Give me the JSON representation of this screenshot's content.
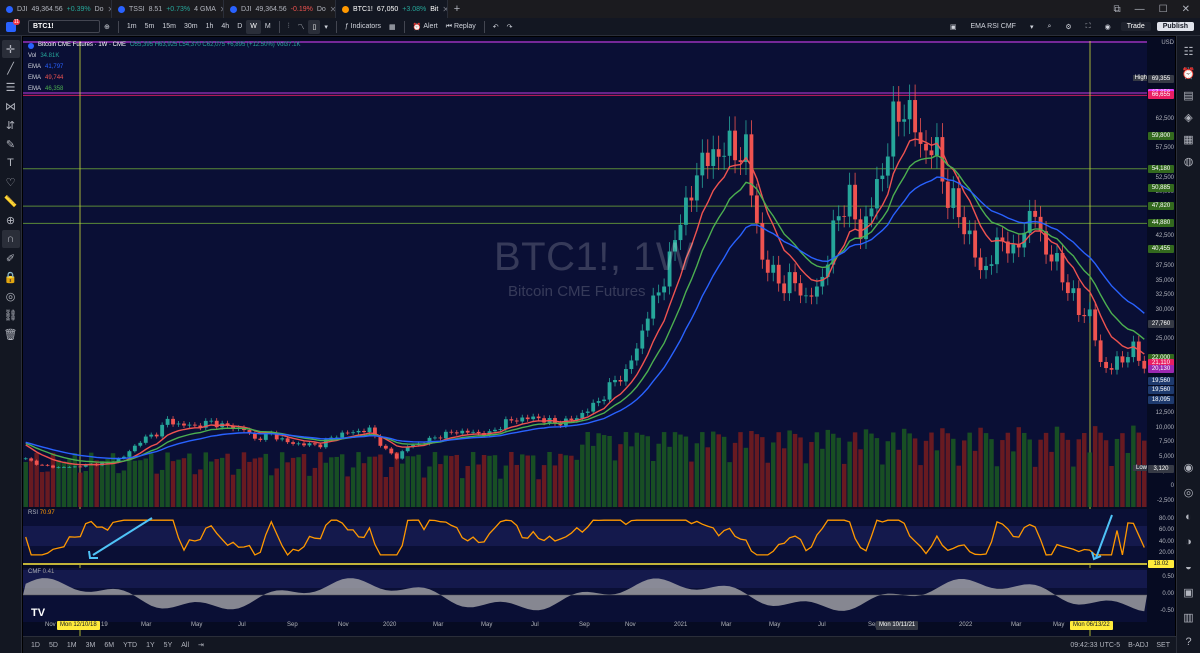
{
  "browser_tabs": [
    {
      "symbol": "DJI",
      "change": "+0.39%",
      "more": "Do",
      "dir": "up",
      "active": false
    },
    {
      "symbol": "TSSI",
      "change": "+0.73%",
      "more": "4 GMA",
      "dir": "up",
      "active": false
    },
    {
      "symbol": "DJI",
      "change": "-0.19%",
      "more": "Do",
      "dir": "dn",
      "active": false
    },
    {
      "symbol": "BTC1!",
      "change": "+3.08%",
      "more": "Bit",
      "dir": "up",
      "active": true
    }
  ],
  "browser_tab_prices": [
    "49,364.56",
    "8.51",
    "49,364.56",
    "67,050"
  ],
  "toolbar": {
    "notif_badge": "11",
    "symbol": "BTC1!",
    "intervals": [
      "1m",
      "5m",
      "15m",
      "30m",
      "1h",
      "4h",
      "D",
      "W",
      "M"
    ],
    "selected_interval": "W",
    "indicators_label": "Indicators",
    "alert_label": "Alert",
    "replay_label": "Replay",
    "layout_name": "EMA RSI CMF",
    "trade_label": "Trade",
    "publish_label": "Publish"
  },
  "legend": {
    "symbol_title": "Bitcoin CME Futures · 1W · CME",
    "ohlc": "O55,395 H63,925 L54,370 C62,075 +6,895 (+12.50%) Vol37.1K",
    "vol_label": "Vol",
    "vol_value": "34.81K",
    "ema_rows": [
      {
        "label": "EMA",
        "value": "41,797",
        "color": "#2962ff"
      },
      {
        "label": "EMA",
        "value": "49,744",
        "color": "#ef5350"
      },
      {
        "label": "EMA",
        "value": "46,358",
        "color": "#4caf50"
      }
    ]
  },
  "watermark": {
    "symbol": "BTC1!, 1W",
    "name": "Bitcoin CME Futures"
  },
  "rsi": {
    "label": "RSI",
    "value": "70.97"
  },
  "cmf": {
    "label": "CMF",
    "value": "0.41"
  },
  "price_axis": {
    "currency": "USD",
    "ticks": [
      "62,500",
      "57,500",
      "52,500",
      "50,000",
      "42,500",
      "37,500",
      "35,000",
      "32,500",
      "30,000",
      "25,000",
      "12,500",
      "10,000",
      "7,500",
      "5,000",
      "2,500",
      "0",
      "-2,500"
    ],
    "tags": [
      {
        "text": "High",
        "value": "69,355",
        "color": "#363a45"
      },
      {
        "text": "",
        "value": "67,050",
        "color": "#e040fb"
      },
      {
        "text": "",
        "value": "66,655",
        "color": "#e91e63"
      },
      {
        "text": "",
        "value": "59,800",
        "color": "#33691e"
      },
      {
        "text": "",
        "value": "54,180",
        "color": "#33691e"
      },
      {
        "text": "",
        "value": "50,885",
        "color": "#33691e"
      },
      {
        "text": "",
        "value": "47,820",
        "color": "#33691e"
      },
      {
        "text": "",
        "value": "44,880",
        "color": "#33691e"
      },
      {
        "text": "",
        "value": "40,455",
        "color": "#33691e"
      },
      {
        "text": "",
        "value": "27,760",
        "color": "#363a45"
      },
      {
        "text": "",
        "value": "22,000",
        "color": "#33691e"
      },
      {
        "text": "",
        "value": "21,110",
        "color": "#e91e63"
      },
      {
        "text": "",
        "value": "20,130",
        "color": "#9c27b0"
      },
      {
        "text": "",
        "value": "19,560",
        "color": "#1e3a6e"
      },
      {
        "text": "",
        "value": "19,560",
        "color": "#1e3a6e"
      },
      {
        "text": "",
        "value": "18,095",
        "color": "#1e3a6e"
      },
      {
        "text": "Low",
        "value": "3,120",
        "color": "#363a45"
      }
    ],
    "rsi_ticks": [
      "80.00",
      "60.00",
      "40.00",
      "20.00"
    ],
    "rsi_tag": "18.02",
    "cmf_ticks": [
      "0.50",
      "0.00",
      "-0.50"
    ]
  },
  "time_axis": {
    "labels": [
      "Nov",
      "Mar",
      "May",
      "Jul",
      "Sep",
      "Nov",
      "2020",
      "Mar",
      "May",
      "Jul",
      "Sep",
      "Nov",
      "2021",
      "Mar",
      "May",
      "Jul",
      "Sep",
      "2022",
      "Mar",
      "May"
    ],
    "highlight_1": "Mon 12/10/18",
    "highlight_1_suffix": "19",
    "highlight_2": "Mon 10/11/21",
    "highlight_3": "Mon 06/13/22"
  },
  "bottom_bar": {
    "ranges": [
      "1D",
      "5D",
      "1M",
      "3M",
      "6M",
      "YTD",
      "1Y",
      "5Y",
      "All"
    ],
    "clock": "09:42:33 UTC-5",
    "adj": "B-ADJ",
    "set": "SET"
  },
  "chart_data": {
    "type": "candlestick",
    "timeframe": "1W",
    "start_date": "2018-11",
    "price_range": [
      -2500,
      70000
    ],
    "series": [
      {
        "name": "EMA",
        "color": "#2962ff"
      },
      {
        "name": "EMA",
        "color": "#ef5350"
      },
      {
        "name": "EMA",
        "color": "#4caf50"
      }
    ],
    "close_points": [
      [
        0,
        4800
      ],
      [
        3,
        3700
      ],
      [
        6,
        3400
      ],
      [
        9,
        3500
      ],
      [
        12,
        3900
      ],
      [
        15,
        4100
      ],
      [
        18,
        5200
      ],
      [
        21,
        7900
      ],
      [
        24,
        9200
      ],
      [
        26,
        11400
      ],
      [
        28,
        10700
      ],
      [
        31,
        10400
      ],
      [
        34,
        11100
      ],
      [
        37,
        10300
      ],
      [
        40,
        9900
      ],
      [
        42,
        8200
      ],
      [
        45,
        9100
      ],
      [
        48,
        7600
      ],
      [
        51,
        7300
      ],
      [
        54,
        7200
      ],
      [
        57,
        8900
      ],
      [
        60,
        9400
      ],
      [
        63,
        9800
      ],
      [
        66,
        6300
      ],
      [
        68,
        5100
      ],
      [
        70,
        6900
      ],
      [
        73,
        7700
      ],
      [
        76,
        8800
      ],
      [
        79,
        9500
      ],
      [
        82,
        9300
      ],
      [
        85,
        9100
      ],
      [
        88,
        11100
      ],
      [
        91,
        11700
      ],
      [
        94,
        11800
      ],
      [
        97,
        10900
      ],
      [
        100,
        11400
      ],
      [
        103,
        13100
      ],
      [
        106,
        15600
      ],
      [
        108,
        18300
      ],
      [
        110,
        19400
      ],
      [
        112,
        23800
      ],
      [
        114,
        29300
      ],
      [
        116,
        33500
      ],
      [
        118,
        38000
      ],
      [
        120,
        46500
      ],
      [
        122,
        49000
      ],
      [
        124,
        57000
      ],
      [
        126,
        55000
      ],
      [
        128,
        59000
      ],
      [
        130,
        56000
      ],
      [
        132,
        58500
      ],
      [
        133,
        50000
      ],
      [
        135,
        39000
      ],
      [
        137,
        36000
      ],
      [
        139,
        34500
      ],
      [
        141,
        35000
      ],
      [
        143,
        32000
      ],
      [
        145,
        33500
      ],
      [
        147,
        39000
      ],
      [
        149,
        47000
      ],
      [
        151,
        49000
      ],
      [
        153,
        43000
      ],
      [
        155,
        48000
      ],
      [
        157,
        54000
      ],
      [
        159,
        62000
      ],
      [
        161,
        65000
      ],
      [
        163,
        61000
      ],
      [
        165,
        57000
      ],
      [
        167,
        57500
      ],
      [
        169,
        49000
      ],
      [
        171,
        47000
      ],
      [
        173,
        42000
      ],
      [
        175,
        37000
      ],
      [
        177,
        38500
      ],
      [
        179,
        43000
      ],
      [
        181,
        39000
      ],
      [
        183,
        44500
      ],
      [
        185,
        46500
      ],
      [
        187,
        40000
      ],
      [
        189,
        38000
      ],
      [
        191,
        34000
      ],
      [
        193,
        30000
      ],
      [
        195,
        29500
      ],
      [
        197,
        21000
      ],
      [
        199,
        20300
      ],
      [
        201,
        22000
      ],
      [
        203,
        23500
      ],
      [
        205,
        20500
      ]
    ],
    "rsi_min_markers": [
      {
        "label": "Mon 12/10/18"
      },
      {
        "label": "Mon 06/13/22"
      }
    ]
  }
}
